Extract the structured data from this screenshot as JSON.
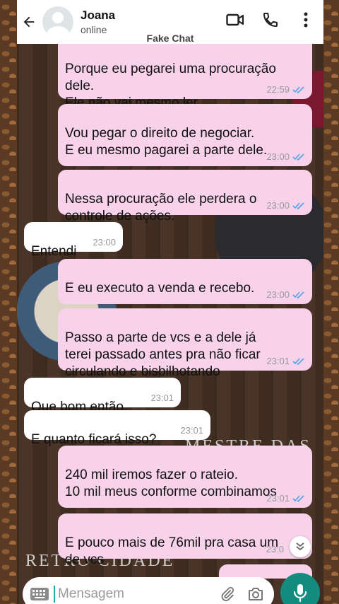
{
  "header": {
    "contact_name": "Joana",
    "contact_status": "online",
    "back_icon": "arrow-left-icon",
    "video_icon": "video-camera-icon",
    "phone_icon": "phone-icon",
    "menu_icon": "more-vertical-icon"
  },
  "app_label": "Fake Chat",
  "messages": [
    {
      "dir": "out",
      "text": "Porque eu pegarei uma procuração\ndele.\nEle não vai mesmo ler",
      "time": "22:59",
      "read": true
    },
    {
      "dir": "out",
      "text": "Vou pegar o direito de negociar.\nE eu mesmo pagarei a parte dele.",
      "time": "23:00",
      "read": true
    },
    {
      "dir": "out",
      "text": "Nessa procuração ele perdera o\ncontrole de ações.",
      "time": "23:00",
      "read": true
    },
    {
      "dir": "in",
      "text": "Entendi",
      "time": "23:00"
    },
    {
      "dir": "out",
      "text": "E eu executo a venda e recebo.",
      "time": "23:00",
      "read": true
    },
    {
      "dir": "out",
      "text": "Passo a parte de vcs e a dele já\nterei passado antes pra não ficar\ncirculando e bisbilhotando",
      "time": "23:01",
      "read": true
    },
    {
      "dir": "in",
      "text": "Que bom então.",
      "time": "23:01"
    },
    {
      "dir": "in",
      "text": "E quanto ficará isso?",
      "time": "23:01"
    },
    {
      "dir": "out",
      "text": "240 mil iremos fazer o rateio.\n10 mil meus conforme combinamos",
      "time": "23:01",
      "read": true
    },
    {
      "dir": "out",
      "text": "E pouco mais de 76mil pra casa um\nde vcs",
      "time": "23:0"
    }
  ],
  "watermarks": {
    "top": "MESTRE DAS",
    "bottom": "RETRO CIDADE"
  },
  "composer": {
    "placeholder": "Mensagem",
    "keyboard_icon": "keyboard-icon",
    "attach_icon": "paperclip-icon",
    "camera_icon": "camera-icon",
    "mic_icon": "microphone-icon",
    "scroll_icon": "double-chevron-down-icon"
  },
  "colors": {
    "outgoing_bubble": "#f7d2ea",
    "incoming_bubble": "#ffffff",
    "read_ticks": "#4fa3e0",
    "mic_button": "#128c7e"
  }
}
